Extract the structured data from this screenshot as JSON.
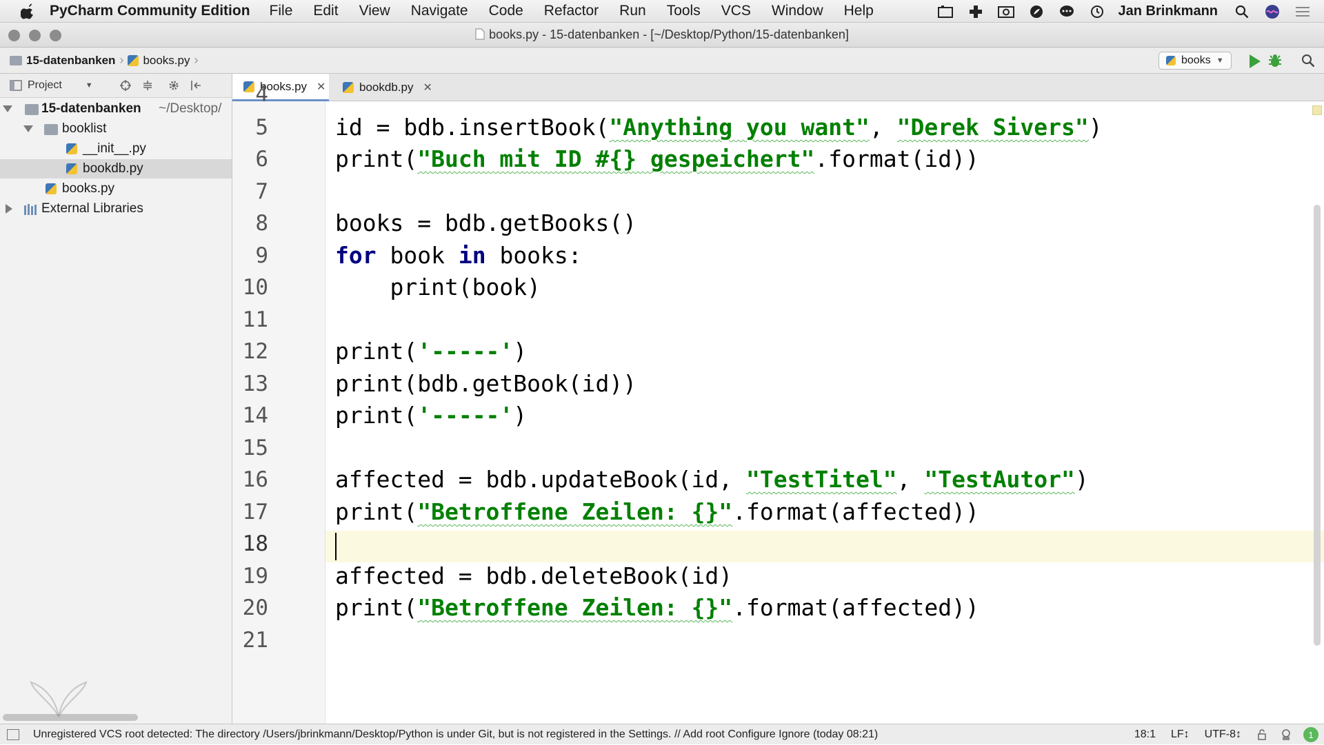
{
  "menubar": {
    "app_name": "PyCharm Community Edition",
    "items": [
      "File",
      "Edit",
      "View",
      "Navigate",
      "Code",
      "Refactor",
      "Run",
      "Tools",
      "VCS",
      "Window",
      "Help"
    ],
    "user": "Jan Brinkmann"
  },
  "window": {
    "title": "books.py - 15-datenbanken - [~/Desktop/Python/15-datenbanken]"
  },
  "navbar": {
    "crumb_project": "15-datenbanken",
    "crumb_file": "books.py",
    "run_config": "books"
  },
  "project_panel": {
    "title": "Project",
    "tree": {
      "root": "15-datenbanken",
      "root_path": "~/Desktop/",
      "folder": "booklist",
      "file_init": "__init__.py",
      "file_bookdb": "bookdb.py",
      "file_books": "books.py",
      "external": "External Libraries"
    }
  },
  "tabs": [
    {
      "label": "books.py",
      "active": true
    },
    {
      "label": "bookdb.py",
      "active": false
    }
  ],
  "editor": {
    "first_line_partial": "4",
    "line_numbers": [
      "5",
      "6",
      "7",
      "8",
      "9",
      "10",
      "11",
      "12",
      "13",
      "14",
      "15",
      "16",
      "17",
      "18",
      "19",
      "20",
      "21"
    ],
    "current_line": "18",
    "code": {
      "l5_a": "id = bdb.insertBook(",
      "l5_s1": "\"Anything you want\"",
      "l5_b": ", ",
      "l5_s2": "\"Derek Sivers\"",
      "l5_c": ")",
      "l6_a": "print(",
      "l6_s": "\"Buch mit ID #{} gespeichert\"",
      "l6_b": ".format(id))",
      "l8": "books = bdb.getBooks()",
      "l9_kw1": "for",
      "l9_a": " book ",
      "l9_kw2": "in",
      "l9_b": " books:",
      "l10": "    print(book)",
      "l12_a": "print(",
      "l12_s": "'-----'",
      "l12_b": ")",
      "l13": "print(bdb.getBook(id))",
      "l14_a": "print(",
      "l14_s": "'-----'",
      "l14_b": ")",
      "l16_a": "affected = bdb.updateBook(id, ",
      "l16_s1": "\"TestTitel\"",
      "l16_b": ", ",
      "l16_s2": "\"TestAutor\"",
      "l16_c": ")",
      "l17_a": "print(",
      "l17_s": "\"Betroffene Zeilen: {}\"",
      "l17_b": ".format(affected))",
      "l19": "affected = bdb.deleteBook(id)",
      "l20_a": "print(",
      "l20_s": "\"Betroffene Zeilen: {}\"",
      "l20_b": ".format(affected))"
    }
  },
  "statusbar": {
    "message": "Unregistered VCS root detected: The directory /Users/jbrinkmann/Desktop/Python is under Git, but is not registered in the Settings. // Add root  Configure  Ignore (today 08:21)",
    "position": "18:1",
    "line_sep": "LF↕",
    "encoding": "UTF-8↕",
    "notifications": "1"
  },
  "colors": {
    "keyword": "#000080",
    "string": "#008000",
    "current_line": "#fcf9e1",
    "run_green": "#3ba13b"
  }
}
